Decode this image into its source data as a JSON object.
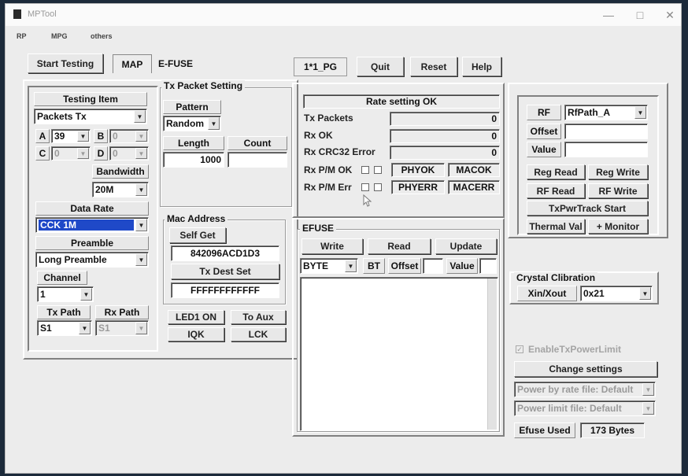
{
  "window": {
    "title": "MPTool"
  },
  "menu": [
    "RP",
    "MPG",
    "others"
  ],
  "toolbar": {
    "start_testing": "Start Testing",
    "tab_map": "MAP",
    "tab_efuse": "E-FUSE",
    "mode": "1*1_PG",
    "quit": "Quit",
    "reset": "Reset",
    "help": "Help"
  },
  "testing": {
    "title": "Testing Item",
    "item_value": "Packets Tx",
    "a_label": "A",
    "a_value": "39",
    "b_label": "B",
    "b_value": "0",
    "c_label": "C",
    "c_value": "0",
    "d_label": "D",
    "d_value": "0",
    "bandwidth_label": "Bandwidth",
    "bandwidth_value": "20M",
    "data_rate_label": "Data Rate",
    "data_rate_value": "CCK 1M",
    "preamble_label": "Preamble",
    "preamble_value": "Long Preamble",
    "channel_label": "Channel",
    "channel_value": "1",
    "tx_path_label": "Tx Path",
    "tx_path_value": "S1",
    "rx_path_label": "Rx Path",
    "rx_path_value": "S1"
  },
  "tx_packet": {
    "title": "Tx Packet Setting",
    "pattern_label": "Pattern",
    "pattern_value": "Random",
    "length_label": "Length",
    "length_value": "1000",
    "count_label": "Count",
    "count_value": ""
  },
  "mac": {
    "title": "Mac Address",
    "self_get": "Self Get",
    "self_value": "842096ACD1D3",
    "tx_dest_set": "Tx Dest Set",
    "dest_value": "FFFFFFFFFFFF"
  },
  "led": {
    "led1_on": "LED1 ON",
    "to_aux": "To Aux",
    "iqk": "IQK",
    "lck": "LCK"
  },
  "stats": {
    "status": "Rate setting OK",
    "tx_packets_label": "Tx Packets",
    "tx_packets_value": "0",
    "rx_ok_label": "Rx OK",
    "rx_ok_value": "0",
    "rx_crc_label": "Rx CRC32 Error",
    "rx_crc_value": "0",
    "rx_pm_ok_label": "Rx P/M OK",
    "phyok": "PHYOK",
    "macok": "MACOK",
    "rx_pm_err_label": "Rx P/M Err",
    "phyerr": "PHYERR",
    "macerr": "MACERR"
  },
  "efuse": {
    "title": "EFUSE",
    "write": "Write",
    "read": "Read",
    "update": "Update",
    "type_value": "BYTE",
    "bt": "BT",
    "offset_label": "Offset",
    "value_label": "Value"
  },
  "rf": {
    "rf_label": "RF",
    "rf_value": "RfPath_A",
    "offset_label": "Offset",
    "value_label": "Value",
    "reg_read": "Reg Read",
    "reg_write": "Reg Write",
    "rf_read": "RF Read",
    "rf_write": "RF Write",
    "txpwr_track": "TxPwrTrack Start",
    "thermal_val": "Thermal Val",
    "monitor": "+ Monitor"
  },
  "crystal": {
    "title": "Crystal Clibration",
    "xin_label": "Xin/Xout",
    "value": "0x21"
  },
  "power": {
    "enable_label": "EnableTxPowerLimit",
    "change_settings": "Change settings",
    "rate_file": "Power by rate file: Default",
    "limit_file": "Power limit file: Default",
    "efuse_used_label": "Efuse Used",
    "efuse_used_value": "173 Bytes"
  },
  "colors": {
    "selection": "#1f49c8",
    "window_bg": "#ececec"
  }
}
